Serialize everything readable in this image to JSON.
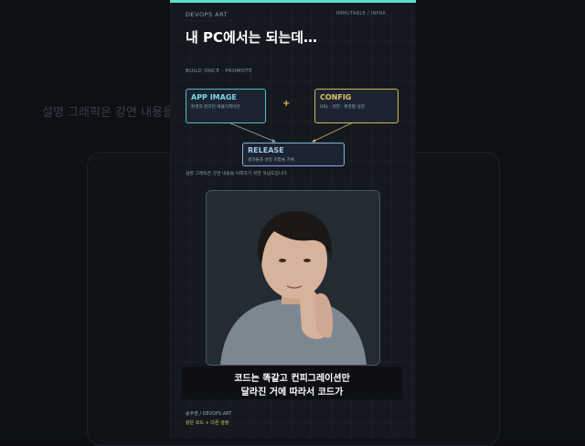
{
  "background": {
    "ghost_text": "설명 그래픽은 강연 내용을"
  },
  "header": {
    "brand": "DEVOPS ART",
    "tag": "IMMUTABLE / INFRA",
    "accent_color": "#5ee0c8"
  },
  "title": "내 PC에서는 되는데…",
  "section_label": "BUILD ONCE · PROMOTE",
  "diagram": {
    "app_image": {
      "title": "APP IMAGE",
      "subtitle": "환경과 분리된 애플리케이션",
      "color": "#5fb8c4"
    },
    "plus": "+",
    "config": {
      "title": "CONFIG",
      "subtitle": "URL · 권한 · 환경별 설정",
      "color": "#d8b45a"
    },
    "release": {
      "title": "RELEASE",
      "subtitle": "결과물과 설정 조합을 기록",
      "color": "#8ab0e0"
    }
  },
  "note": "설명 그래픽은 강연 내용을 이해하기 위한 개념도입니다.",
  "caption": {
    "line1": "코드는 똑같고 컨피그레이션만",
    "line2": "달라진 거에 따라서 코드가"
  },
  "speaker": {
    "name": "송주영  /  DEVOPS ART",
    "subtitle": "같은 코드 + 다른 설정"
  }
}
